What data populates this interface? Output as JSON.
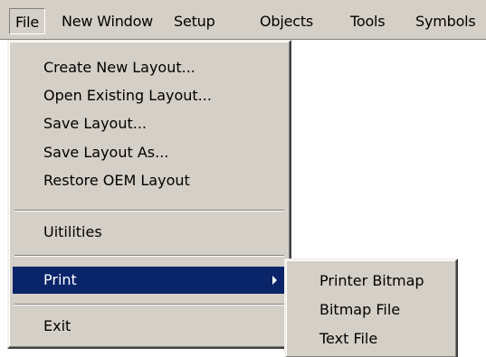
{
  "menubar": {
    "items": [
      "File",
      "New Window",
      "Setup",
      "Objects",
      "Tools",
      "Symbols"
    ]
  },
  "file_menu": {
    "items": [
      "Create New Layout...",
      "Open Existing Layout...",
      "Save Layout...",
      "Save Layout As...",
      "Restore OEM Layout",
      "Uitilities",
      "Print",
      "Exit"
    ],
    "highlighted": "Print"
  },
  "print_submenu": {
    "items": [
      "Printer Bitmap",
      "Bitmap File",
      "Text File"
    ]
  },
  "colors": {
    "menu_face": "#d4d0c8",
    "highlight": "#0a246a",
    "workspace": "#ffffff"
  }
}
